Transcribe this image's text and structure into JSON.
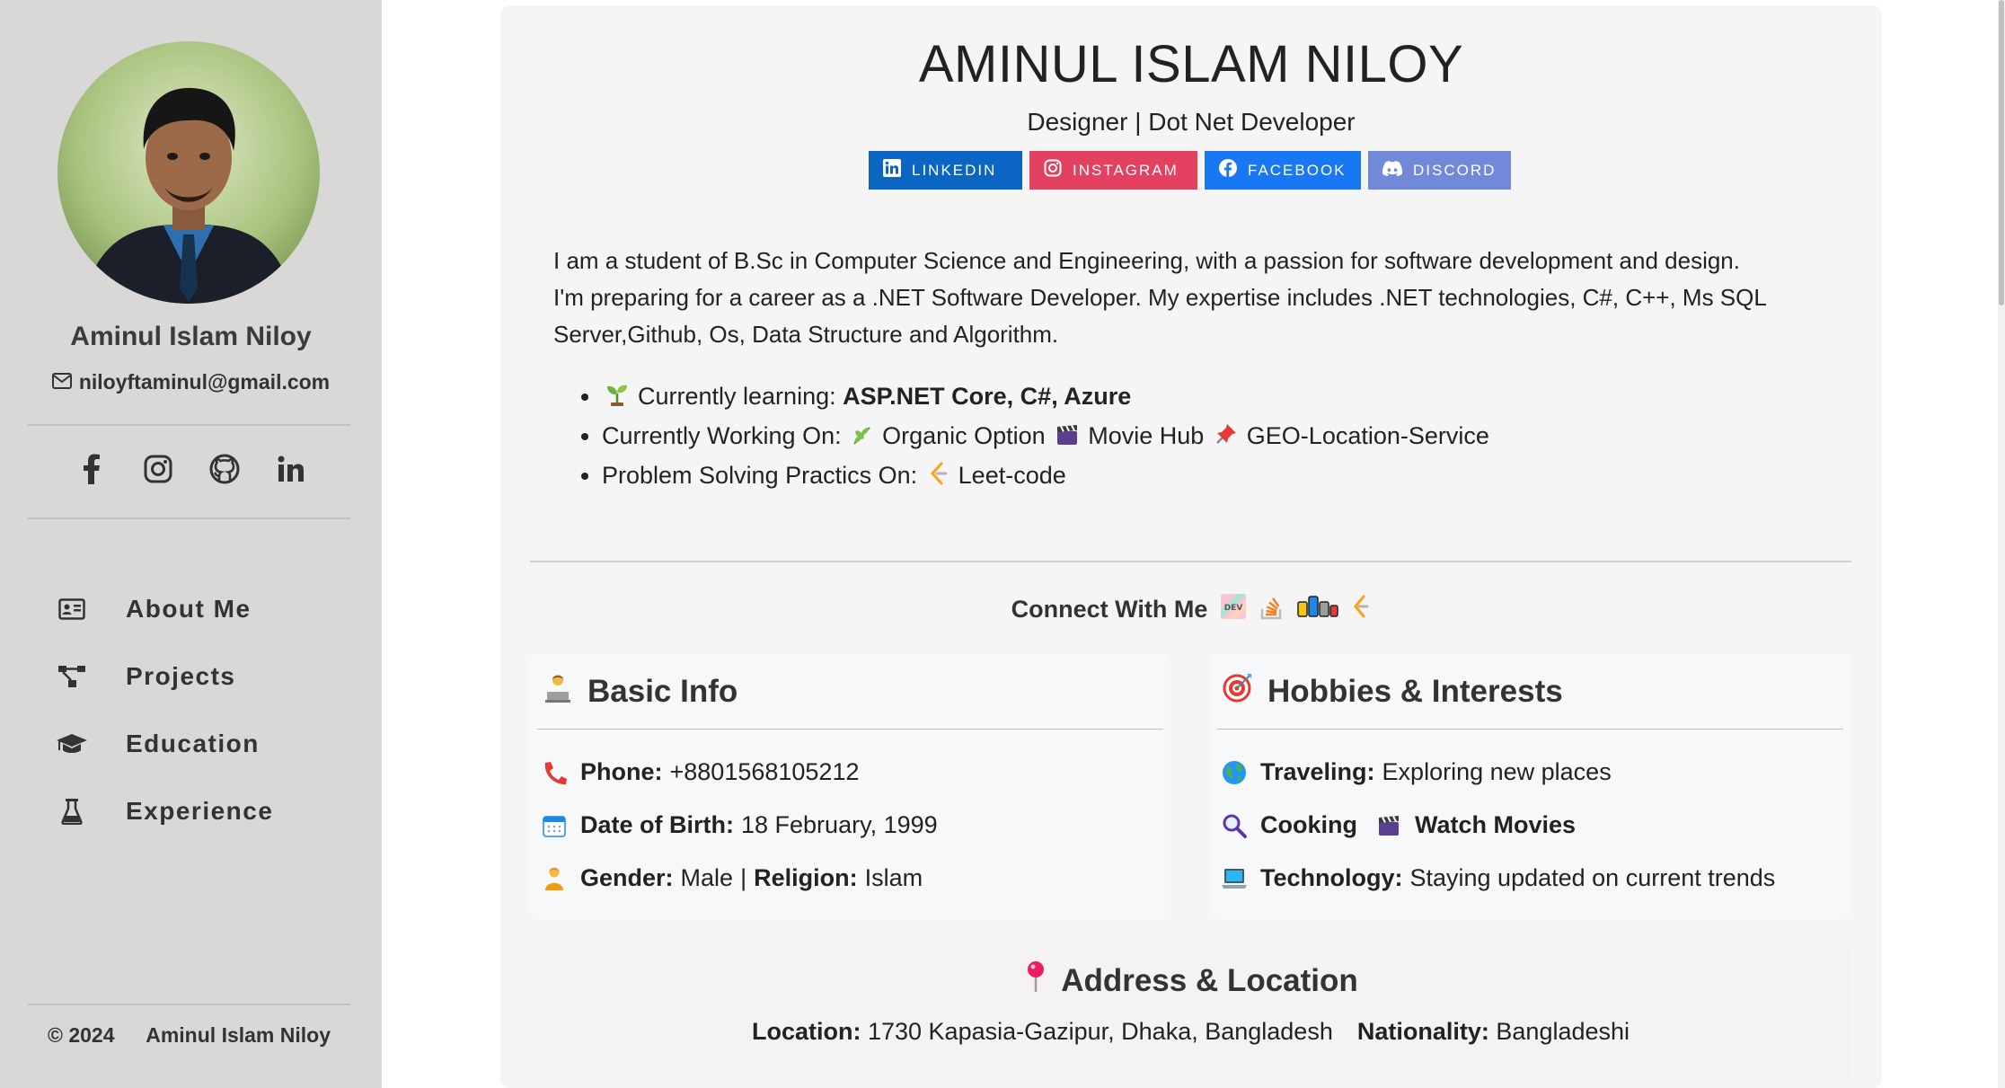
{
  "sidebar": {
    "name": "Aminul Islam Niloy",
    "email": "niloyftaminul@gmail.com",
    "social_icons": [
      "facebook-icon",
      "instagram-icon",
      "github-icon",
      "linkedin-icon"
    ],
    "nav": [
      {
        "label": "About Me",
        "icon": "id-card-icon"
      },
      {
        "label": "Projects",
        "icon": "project-diagram-icon"
      },
      {
        "label": "Education",
        "icon": "graduation-cap-icon"
      },
      {
        "label": "Experience",
        "icon": "flask-icon"
      }
    ],
    "footer": {
      "copyright": "© 2024",
      "name": "Aminul Islam Niloy"
    }
  },
  "header": {
    "title": "AMINUL ISLAM NILOY",
    "subtitle": "Designer | Dot Net Developer",
    "badges": [
      {
        "label": "LINKEDIN",
        "color": "#0a66c2"
      },
      {
        "label": "INSTAGRAM",
        "color": "#e4405f"
      },
      {
        "label": "FACEBOOK",
        "color": "#1877f2"
      },
      {
        "label": "DISCORD",
        "color": "#7289da"
      }
    ]
  },
  "intro": {
    "line1": "I am a student of B.Sc in Computer Science and Engineering, with a passion for software development and design.",
    "line2": "I'm preparing for a career as a .NET Software Developer. My expertise includes .NET technologies, C#, C++, Ms SQL",
    "line3": "Server,Github, Os, Data Structure and Algorithm."
  },
  "bullets": {
    "learning_label": "Currently learning:",
    "learning_value": "ASP.NET Core, C#, Azure",
    "working_label": "Currently Working On:",
    "working_items": [
      "Organic Option",
      "Movie Hub",
      "GEO-Location-Service"
    ],
    "problem_label": "Problem Solving Practics On:",
    "problem_value": "Leet-code"
  },
  "connect": {
    "label": "Connect With Me"
  },
  "basic_info": {
    "title": "Basic Info",
    "phone_label": "Phone:",
    "phone": "+8801568105212",
    "dob_label": "Date of Birth:",
    "dob": "18 February, 1999",
    "gender_label": "Gender:",
    "gender": "Male",
    "separator": "|",
    "religion_label": "Religion:",
    "religion": "Islam"
  },
  "hobbies": {
    "title": "Hobbies & Interests",
    "traveling_label": "Traveling:",
    "traveling": "Exploring new places",
    "cooking_label": "Cooking",
    "movies_label": "Watch Movies",
    "tech_label": "Technology:",
    "tech": "Staying updated on current trends"
  },
  "address": {
    "title": "Address & Location",
    "location_label": "Location:",
    "location": "1730 Kapasia-Gazipur, Dhaka, Bangladesh",
    "nationality_label": "Nationality:",
    "nationality": "Bangladeshi"
  }
}
